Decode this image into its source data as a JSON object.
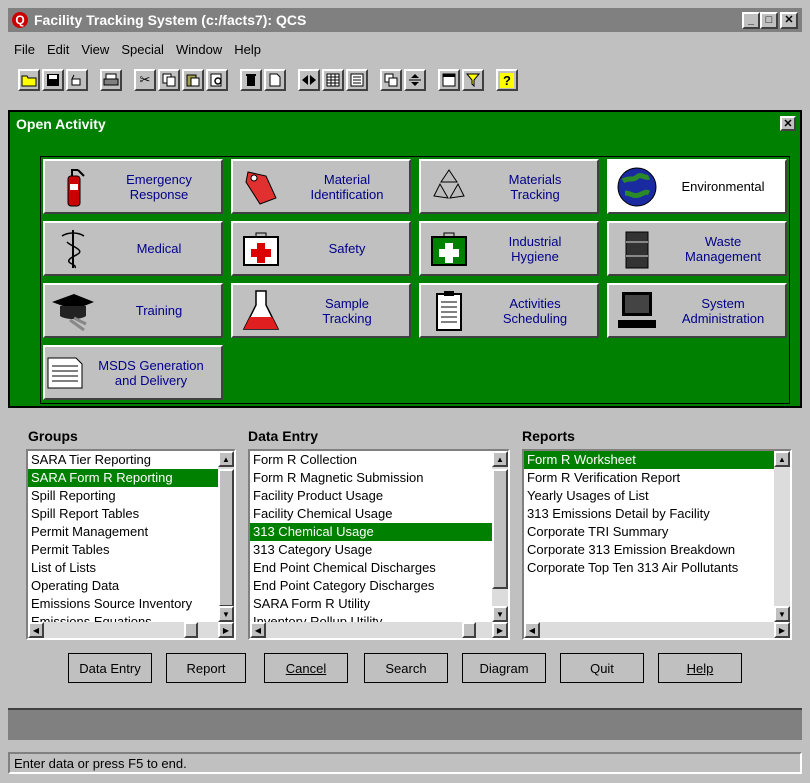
{
  "window": {
    "title": "Facility Tracking System (c:/facts7): QCS",
    "app_icon": "Q",
    "controls": [
      "_",
      "□",
      "✕"
    ]
  },
  "menu": [
    "File",
    "Edit",
    "View",
    "Special",
    "Window",
    "Help"
  ],
  "toolbar": {
    "icons": [
      "open-folder-icon",
      "save-icon",
      "undo-icon",
      "print-icon",
      "cut-icon",
      "copy-icon",
      "paste-icon",
      "find-icon",
      "delete-icon",
      "new-page-icon",
      "prev-next-icon",
      "grid-icon",
      "form-icon",
      "cascade-icon",
      "split-icon",
      "window-icon",
      "filter-icon",
      "help-icon"
    ]
  },
  "activity": {
    "title": "Open Activity",
    "close": "✕",
    "background": "#008000",
    "tiles": [
      {
        "label": "Emergency\nResponse",
        "icon": "fire-extinguisher-icon"
      },
      {
        "label": "Material\nIdentification",
        "icon": "tag-icon"
      },
      {
        "label": "Materials\nTracking",
        "icon": "recycle-icon"
      },
      {
        "label": "Environmental",
        "icon": "globe-icon",
        "selected": true
      },
      {
        "label": "Medical",
        "icon": "caduceus-icon"
      },
      {
        "label": "Safety",
        "icon": "first-aid-kit-icon"
      },
      {
        "label": "Industrial\nHygiene",
        "icon": "green-cross-kit-icon"
      },
      {
        "label": "Waste\nManagement",
        "icon": "drum-icon"
      },
      {
        "label": "Training",
        "icon": "graduation-cap-icon"
      },
      {
        "label": "Sample\nTracking",
        "icon": "flask-icon"
      },
      {
        "label": "Activities\nScheduling",
        "icon": "clipboard-icon"
      },
      {
        "label": "System\nAdministration",
        "icon": "computer-icon"
      },
      {
        "label": "MSDS Generation\nand Delivery",
        "icon": "document-icon"
      }
    ]
  },
  "groups": {
    "label": "Groups",
    "items": [
      "SARA Tier Reporting",
      "SARA Form R Reporting",
      "Spill Reporting",
      "Spill Report Tables",
      "Permit Management",
      "Permit Tables",
      "List of Lists",
      "Operating Data",
      "Emissions Source Inventory",
      "Emissions Equations"
    ],
    "selected_index": 1
  },
  "data_entry": {
    "label": "Data Entry",
    "items": [
      "Form R Collection",
      "Form R Magnetic Submission",
      "Facility Product Usage",
      "Facility Chemical Usage",
      "313 Chemical Usage",
      "313 Category Usage",
      "End Point Chemical Discharges",
      "End Point Category Discharges",
      "SARA Form R Utility",
      "Inventory Rollup Utility"
    ],
    "selected_index": 4
  },
  "reports": {
    "label": "Reports",
    "items": [
      "Form R Worksheet",
      "Form R Verification Report",
      "Yearly Usages of List",
      "313 Emissions Detail by Facility",
      "Corporate TRI Summary",
      "Corporate 313 Emission Breakdown",
      "Corporate Top Ten 313 Air Pollutants"
    ],
    "selected_index": 0
  },
  "buttons": [
    "Data Entry",
    "Report",
    "Cancel",
    "Search",
    "Diagram",
    "Quit",
    "Help"
  ],
  "status": "Enter data or press F5 to end."
}
